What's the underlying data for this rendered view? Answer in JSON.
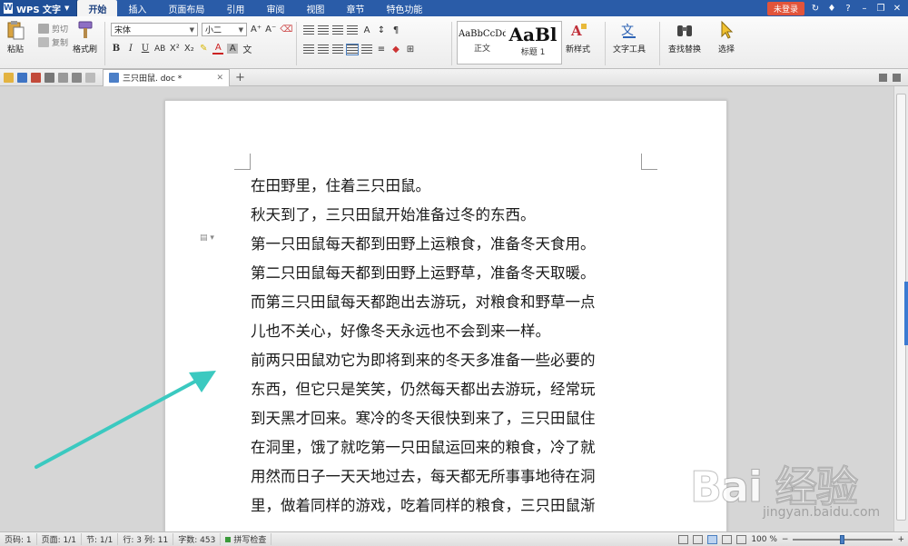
{
  "titlebar": {
    "app_name": "WPS 文字",
    "tabs": [
      "开始",
      "插入",
      "页面布局",
      "引用",
      "审阅",
      "视图",
      "章节",
      "特色功能"
    ],
    "active_tab_index": 0,
    "login_label": "未登录"
  },
  "ribbon": {
    "paste_label": "粘贴",
    "cut_label": "剪切",
    "copy_label": "复制",
    "format_painter_label": "格式刷",
    "font_name": "宋体",
    "font_size": "小二",
    "styles": [
      {
        "sample": "AaBbCcDd",
        "caption": "正文"
      },
      {
        "sample": "AaBl",
        "caption": "标题 1"
      }
    ],
    "new_style_label": "新样式",
    "text_tools_label": "文字工具",
    "find_replace_label": "查找替换",
    "select_label": "选择"
  },
  "tabbar": {
    "doc_tab_label": "三只田鼠. doc *"
  },
  "document": {
    "paragraphs": [
      "在田野里，住着三只田鼠。",
      "秋天到了，三只田鼠开始准备过冬的东西。",
      "第一只田鼠每天都到田野上运粮食，准备冬天食用。",
      "第二只田鼠每天都到田野上运野草，准备冬天取暖。",
      "而第三只田鼠每天都跑出去游玩，对粮食和野草一点",
      "儿也不关心，好像冬天永远也不会到来一样。",
      "前两只田鼠劝它为即将到来的冬天多准备一些必要的",
      "东西，但它只是笑笑，仍然每天都出去游玩，经常玩",
      "到天黑才回来。寒冷的冬天很快到来了，三只田鼠住",
      "在洞里，饿了就吃第一只田鼠运回来的粮食，冷了就",
      "用然而日子一天天地过去，每天都无所事事地待在洞",
      "里，做着同样的游戏，吃着同样的粮食，三只田鼠渐"
    ]
  },
  "watermark": {
    "main": "Bai 经验",
    "sub": "jingyan.baidu.com"
  },
  "statusbar": {
    "page_code": "页码: 1",
    "page": "页面: 1/1",
    "section": "节: 1/1",
    "row_col": "行: 3  列: 11",
    "word_count": "字数: 453",
    "spell_check": "拼写检查",
    "zoom": "100 %"
  },
  "colors": {
    "title_blue": "#2a5ca8",
    "arrow_teal": "#3bc9c0",
    "login_red": "#e2543a"
  }
}
